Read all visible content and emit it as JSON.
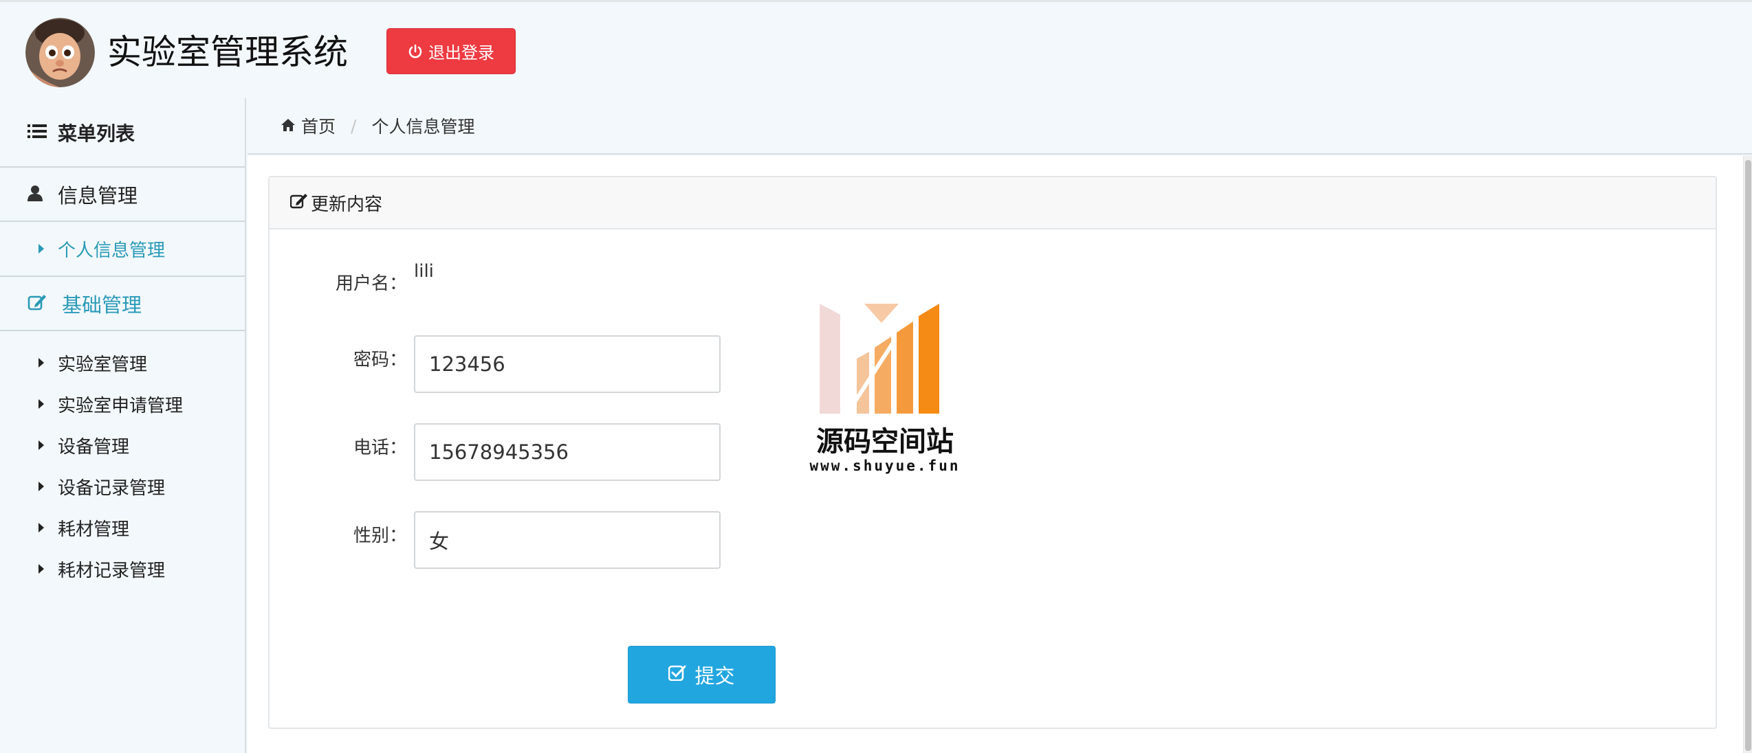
{
  "header": {
    "app_title": "实验室管理系统",
    "logout_label": "退出登录"
  },
  "sidebar": {
    "menu_title": "菜单列表",
    "groups": [
      {
        "label": "信息管理",
        "icon": "user-icon",
        "active": false,
        "sub_items": [
          {
            "label": "个人信息管理",
            "active": true
          }
        ]
      },
      {
        "label": "基础管理",
        "icon": "edit-icon",
        "active": true,
        "sub_items": [
          {
            "label": "实验室管理"
          },
          {
            "label": "实验室申请管理"
          },
          {
            "label": "设备管理"
          },
          {
            "label": "设备记录管理"
          },
          {
            "label": "耗材管理"
          },
          {
            "label": "耗材记录管理"
          }
        ]
      }
    ]
  },
  "breadcrumb": {
    "home": "首页",
    "separator": "/",
    "current": "个人信息管理"
  },
  "panel": {
    "title": "更新内容",
    "form": {
      "username_label": "用户名：",
      "username_value": "lili",
      "password_label": "密码：",
      "password_value": "123456",
      "phone_label": "电话：",
      "phone_value": "15678945356",
      "gender_label": "性别：",
      "gender_value": "女",
      "submit_label": "提交"
    }
  },
  "watermark": {
    "title": "源码空间站",
    "url": "www.shuyue.fun"
  },
  "colors": {
    "logout": "#ee3a41",
    "submit": "#22a6e0",
    "active_menu": "#2a9ab8",
    "background": "#f2f8fb"
  }
}
